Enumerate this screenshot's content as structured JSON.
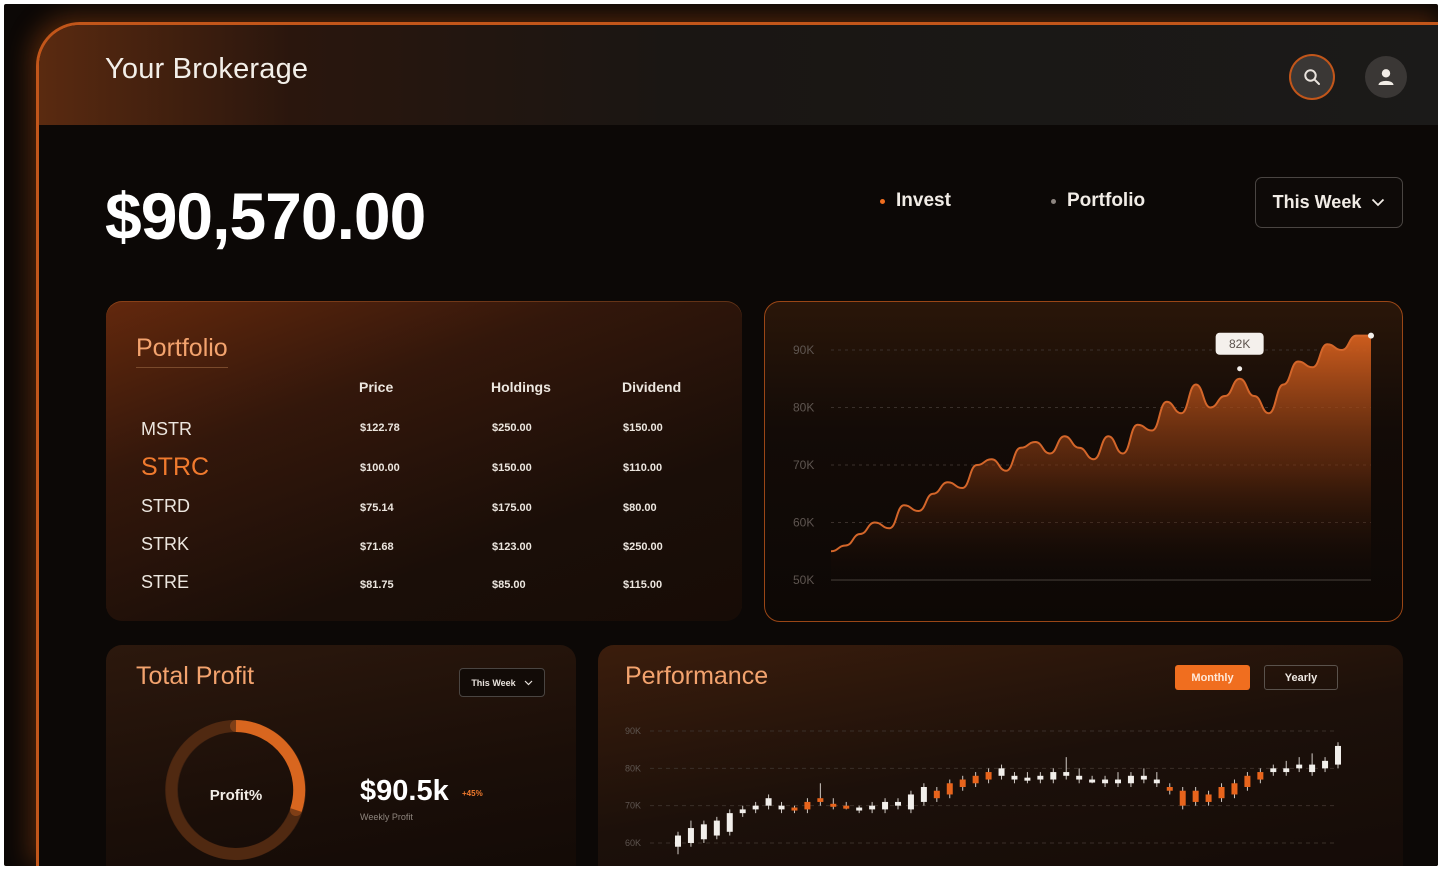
{
  "header": {
    "title": "Your Brokerage"
  },
  "icons": {
    "search": "search-icon",
    "user": "user-icon",
    "chevron": "chevron-down-icon"
  },
  "colors": {
    "accent": "#f06e1f",
    "background": "#0c0806",
    "highlight_text": "#f07a2e"
  },
  "balance": "$90,570.00",
  "nav": {
    "invest": "Invest",
    "portfolio": "Portfolio"
  },
  "period_select": {
    "value": "This Week"
  },
  "portfolio": {
    "title": "Portfolio",
    "columns": [
      "Price",
      "Holdings",
      "Dividend"
    ],
    "rows": [
      {
        "ticker": "MSTR",
        "price": "$122.78",
        "holdings": "$250.00",
        "dividend": "$150.00",
        "highlight": false
      },
      {
        "ticker": "STRC",
        "price": "$100.00",
        "holdings": "$150.00",
        "dividend": "$110.00",
        "highlight": true
      },
      {
        "ticker": "STRD",
        "price": "$75.14",
        "holdings": "$175.00",
        "dividend": "$80.00",
        "highlight": false
      },
      {
        "ticker": "STRK",
        "price": "$71.68",
        "holdings": "$123.00",
        "dividend": "$250.00",
        "highlight": false
      },
      {
        "ticker": "STRE",
        "price": "$81.75",
        "holdings": "$85.00",
        "dividend": "$115.00",
        "highlight": false
      }
    ]
  },
  "value_chart": {
    "tooltip": "82K"
  },
  "total_profit": {
    "title": "Total Profit",
    "select_value": "This Week",
    "donut_label": "Profit%",
    "value": "$90.5k",
    "change": "+45%",
    "subtitle": "Weekly Profit"
  },
  "performance": {
    "title": "Performance",
    "toggle": {
      "monthly": "Monthly",
      "yearly": "Yearly",
      "active": "Monthly"
    }
  },
  "chart_data": [
    {
      "type": "area",
      "title": "",
      "ylabel": "",
      "ylim": [
        50,
        95
      ],
      "yticks": [
        "90K",
        "80K",
        "70K",
        "60K",
        "50K"
      ],
      "grid": true,
      "annotation": {
        "label": "82K",
        "point_index": 28
      },
      "values": [
        55,
        56,
        58,
        60,
        59,
        63,
        62,
        65,
        67,
        66,
        70,
        71,
        69,
        73,
        74,
        72,
        75,
        73,
        71,
        75,
        72,
        77,
        76,
        81,
        79,
        84,
        80,
        82,
        85,
        82,
        79,
        84,
        88,
        87,
        91,
        90,
        93,
        95
      ]
    },
    {
      "type": "candlestick",
      "title": "",
      "ylim": [
        58,
        92
      ],
      "yticks": [
        "90K",
        "80K",
        "70K",
        "60K"
      ],
      "grid": true,
      "candles": [
        {
          "o": 59,
          "c": 62,
          "h": 63,
          "l": 57
        },
        {
          "o": 60,
          "c": 64,
          "h": 66,
          "l": 59
        },
        {
          "o": 61,
          "c": 65,
          "h": 66,
          "l": 60
        },
        {
          "o": 62,
          "c": 66,
          "h": 67,
          "l": 61
        },
        {
          "o": 63,
          "c": 68,
          "h": 69,
          "l": 62
        },
        {
          "o": 68,
          "c": 69,
          "h": 70,
          "l": 67
        },
        {
          "o": 69,
          "c": 70,
          "h": 71,
          "l": 68
        },
        {
          "o": 70,
          "c": 72,
          "h": 73,
          "l": 69
        },
        {
          "o": 69,
          "c": 70,
          "h": 71,
          "l": 68
        },
        {
          "o": 69,
          "c": 69.5,
          "h": 70,
          "l": 68
        },
        {
          "o": 69,
          "c": 71,
          "h": 72,
          "l": 68
        },
        {
          "o": 71,
          "c": 72,
          "h": 76,
          "l": 70
        },
        {
          "o": 70,
          "c": 70.5,
          "h": 72,
          "l": 69
        },
        {
          "o": 69.5,
          "c": 70,
          "h": 71,
          "l": 69
        },
        {
          "o": 69,
          "c": 69.5,
          "h": 70,
          "l": 68
        },
        {
          "o": 69,
          "c": 70,
          "h": 71,
          "l": 68
        },
        {
          "o": 69,
          "c": 71,
          "h": 72,
          "l": 68
        },
        {
          "o": 70,
          "c": 71,
          "h": 72,
          "l": 69
        },
        {
          "o": 69,
          "c": 73,
          "h": 74,
          "l": 68
        },
        {
          "o": 71,
          "c": 75,
          "h": 76,
          "l": 70
        },
        {
          "o": 72,
          "c": 74,
          "h": 75,
          "l": 71
        },
        {
          "o": 73,
          "c": 76,
          "h": 77,
          "l": 72
        },
        {
          "o": 75,
          "c": 77,
          "h": 78,
          "l": 74
        },
        {
          "o": 76,
          "c": 78,
          "h": 79,
          "l": 75
        },
        {
          "o": 77,
          "c": 79,
          "h": 80,
          "l": 76
        },
        {
          "o": 78,
          "c": 80,
          "h": 81,
          "l": 77
        },
        {
          "o": 77,
          "c": 78,
          "h": 79,
          "l": 76
        },
        {
          "o": 77,
          "c": 77.5,
          "h": 79,
          "l": 76
        },
        {
          "o": 77,
          "c": 78,
          "h": 79,
          "l": 76
        },
        {
          "o": 77,
          "c": 79,
          "h": 80,
          "l": 76
        },
        {
          "o": 78,
          "c": 79,
          "h": 83,
          "l": 77
        },
        {
          "o": 77,
          "c": 78,
          "h": 80,
          "l": 76
        },
        {
          "o": 76.5,
          "c": 77,
          "h": 78,
          "l": 76
        },
        {
          "o": 76,
          "c": 77,
          "h": 78,
          "l": 75
        },
        {
          "o": 76,
          "c": 77,
          "h": 79,
          "l": 75
        },
        {
          "o": 76,
          "c": 78,
          "h": 79,
          "l": 75
        },
        {
          "o": 77,
          "c": 78,
          "h": 80,
          "l": 76
        },
        {
          "o": 76,
          "c": 77,
          "h": 79,
          "l": 75
        },
        {
          "o": 74,
          "c": 75,
          "h": 76,
          "l": 73
        },
        {
          "o": 70,
          "c": 74,
          "h": 75,
          "l": 69
        },
        {
          "o": 71,
          "c": 74,
          "h": 75,
          "l": 70
        },
        {
          "o": 71,
          "c": 73,
          "h": 74,
          "l": 70
        },
        {
          "o": 72,
          "c": 75,
          "h": 76,
          "l": 71
        },
        {
          "o": 73,
          "c": 76,
          "h": 77,
          "l": 72
        },
        {
          "o": 75,
          "c": 78,
          "h": 79,
          "l": 74
        },
        {
          "o": 77,
          "c": 79,
          "h": 80,
          "l": 76
        },
        {
          "o": 79,
          "c": 80,
          "h": 81,
          "l": 78
        },
        {
          "o": 79,
          "c": 80,
          "h": 82,
          "l": 78
        },
        {
          "o": 80,
          "c": 81,
          "h": 83,
          "l": 79
        },
        {
          "o": 79,
          "c": 81,
          "h": 84,
          "l": 78
        },
        {
          "o": 80,
          "c": 82,
          "h": 83,
          "l": 79
        },
        {
          "o": 81,
          "c": 86,
          "h": 87,
          "l": 80
        }
      ]
    }
  ]
}
